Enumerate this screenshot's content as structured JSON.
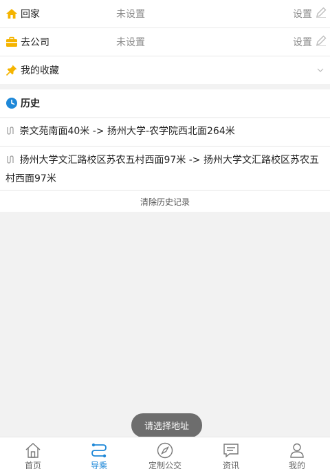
{
  "places": [
    {
      "label": "回家",
      "value": "未设置",
      "action": "设置",
      "icon": "home-icon"
    },
    {
      "label": "去公司",
      "value": "未设置",
      "action": "设置",
      "icon": "briefcase-icon"
    }
  ],
  "favorites": {
    "label": "我的收藏",
    "icon": "pin-icon"
  },
  "history": {
    "title": "历史",
    "items": [
      "崇文苑南面40米 -> 扬州大学-农学院西北面264米",
      "扬州大学文汇路校区苏农五村西面97米 -> 扬州大学文汇路校区苏农五村西面97米"
    ],
    "clear_label": "清除历史记录"
  },
  "toast": "请选择地址",
  "tabs": [
    {
      "label": "首页",
      "icon": "home-outline-icon"
    },
    {
      "label": "导乘",
      "icon": "route-icon",
      "active": true
    },
    {
      "label": "定制公交",
      "icon": "compass-icon"
    },
    {
      "label": "资讯",
      "icon": "message-icon"
    },
    {
      "label": "我的",
      "icon": "user-icon"
    }
  ],
  "colors": {
    "accent": "#1e88d8",
    "home": "#f5b400",
    "work": "#f5b400",
    "pin": "#f5b400",
    "history": "#1e88d8"
  }
}
